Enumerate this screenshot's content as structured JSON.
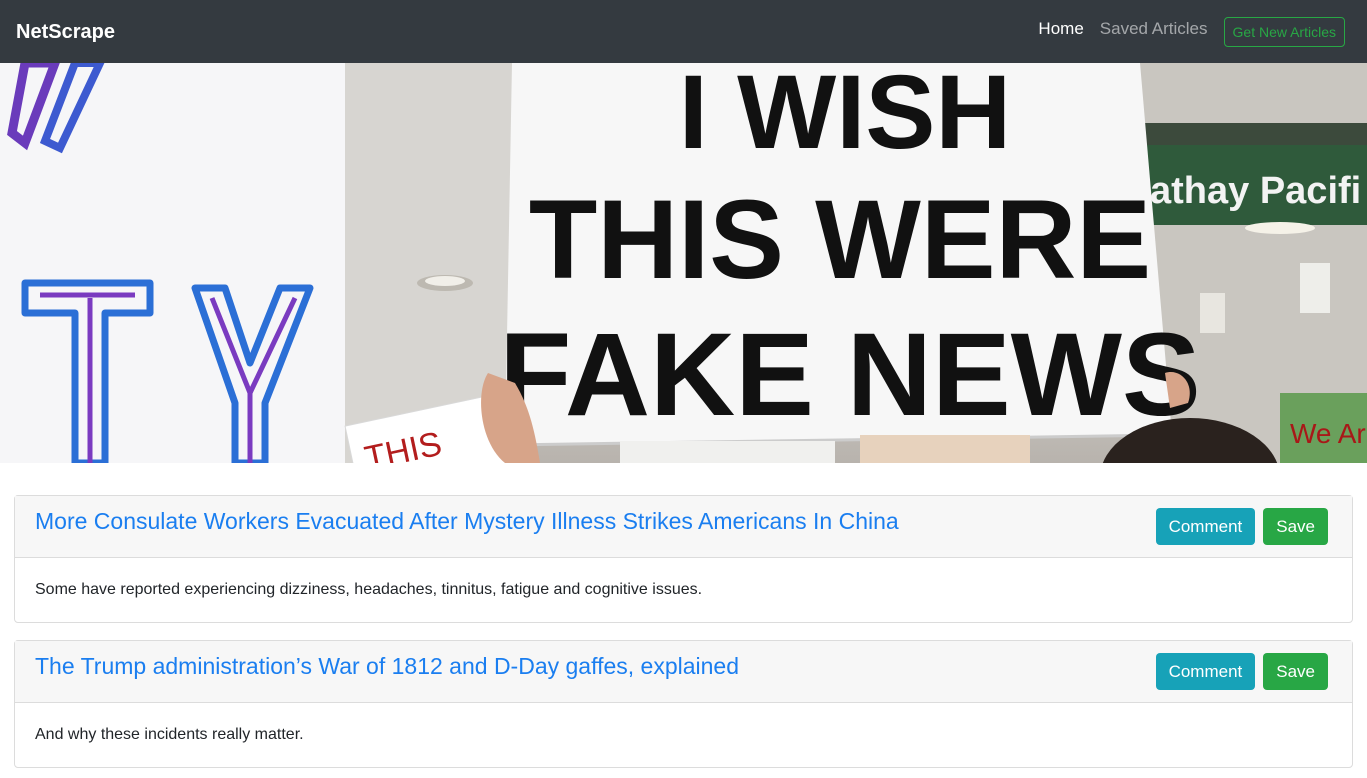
{
  "navbar": {
    "brand": "NetScrape",
    "links": [
      {
        "label": "Home"
      },
      {
        "label": "Saved Articles"
      }
    ],
    "action_button": "Get New Articles"
  },
  "hero": {
    "sign_text": [
      "I WISH",
      "THIS WERE",
      "FAKE NEWS"
    ],
    "left_sign_letters": "TY",
    "small_sign_text": "THIS",
    "background_sign_text": "athay Pacifi",
    "corner_sign_text": "We Ar"
  },
  "articles": [
    {
      "title": "More Consulate Workers Evacuated After Mystery Illness Strikes Americans In China",
      "summary": "Some have reported experiencing dizziness, headaches, tinnitus, fatigue and cognitive issues.",
      "comment_label": "Comment",
      "save_label": "Save"
    },
    {
      "title": "The Trump administration’s War of 1812 and D-Day gaffes, explained",
      "summary": "And why these incidents really matter.",
      "comment_label": "Comment",
      "save_label": "Save"
    }
  ],
  "colors": {
    "navbar_bg": "#343a40",
    "link": "#1a7ef0",
    "info": "#17a2b8",
    "success": "#28a745"
  }
}
